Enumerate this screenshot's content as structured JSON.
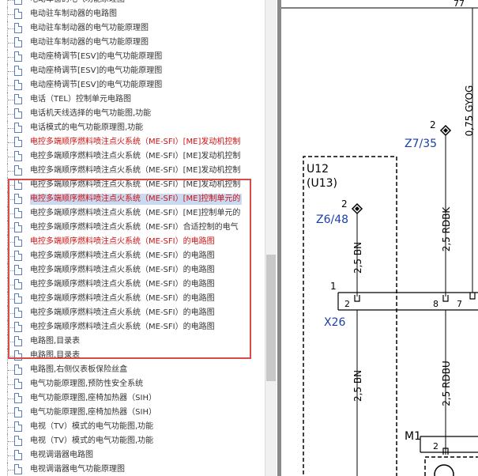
{
  "tree": {
    "items": [
      {
        "label": "电动车窗的电气功能原理图",
        "style": "normal"
      },
      {
        "label": "电动驻车制动器的电路图",
        "style": "normal"
      },
      {
        "label": "电动驻车制动器的电气功能原理图",
        "style": "normal"
      },
      {
        "label": "电动驻车制动器的电气功能原理图",
        "style": "normal"
      },
      {
        "label": "电动座椅调节[ESV]的电气功能原理图",
        "style": "normal"
      },
      {
        "label": "电动座椅调节[ESV]的电气功能原理图",
        "style": "normal"
      },
      {
        "label": "电动座椅调节[ESV]的电气功能原理图",
        "style": "normal"
      },
      {
        "label": "电话（TEL）控制单元电路图",
        "style": "normal"
      },
      {
        "label": "电话机天线选择的电气功能图,功能",
        "style": "normal"
      },
      {
        "label": "电话模式的电气功能原理图,功能",
        "style": "normal"
      },
      {
        "label": "电控多端顺序燃料喷注点火系统（ME-SFI）[ME]发动机控制",
        "style": "red"
      },
      {
        "label": "电控多端顺序燃料喷注点火系统（ME-SFI）[ME]发动机控制",
        "style": "normal"
      },
      {
        "label": "电控多端顺序燃料喷注点火系统（ME-SFI）[ME]发动机控制",
        "style": "normal"
      },
      {
        "label": "电控多端顺序燃料喷注点火系统（ME-SFI）[ME]发动机控制",
        "style": "normal"
      },
      {
        "label": "电控多端顺序燃料喷注点火系统（ME-SFI）[ME]控制单元的",
        "style": "selected"
      },
      {
        "label": "电控多端顺序燃料喷注点火系统（ME-SFI）[ME]控制单元的",
        "style": "normal"
      },
      {
        "label": "电控多端顺序燃料喷注点火系统（ME-SFI）合适控制的电气",
        "style": "normal"
      },
      {
        "label": "电控多端顺序燃料喷注点火系统（ME-SFI）的电路图",
        "style": "red"
      },
      {
        "label": "电控多端顺序燃料喷注点火系统（ME-SFI）的电路图",
        "style": "normal"
      },
      {
        "label": "电控多端顺序燃料喷注点火系统（ME-SFI）的电路图",
        "style": "normal"
      },
      {
        "label": "电控多端顺序燃料喷注点火系统（ME-SFI）的电路图",
        "style": "normal"
      },
      {
        "label": "电控多端顺序燃料喷注点火系统（ME-SFI）的电路图",
        "style": "normal"
      },
      {
        "label": "电控多端顺序燃料喷注点火系统（ME-SFI）的电路图",
        "style": "normal"
      },
      {
        "label": "电控多端顺序燃料喷注点火系统（ME-SFI）的电路图",
        "style": "normal"
      },
      {
        "label": "电路图,目录表",
        "style": "normal"
      },
      {
        "label": "电路图,目录表",
        "style": "normal"
      },
      {
        "label": "电路图,右侧仪表板保险丝盒",
        "style": "normal"
      },
      {
        "label": "电气功能原理图,预防性安全系统",
        "style": "normal"
      },
      {
        "label": "电气功能原理图,座椅加热器（SIH）",
        "style": "normal"
      },
      {
        "label": "电气功能原理图,座椅加热器（SIH）",
        "style": "normal"
      },
      {
        "label": "电视（TV）模式的电气功能图,功能",
        "style": "normal"
      },
      {
        "label": "电视（TV）模式的电气功能图,功能",
        "style": "normal"
      },
      {
        "label": "电视调谐器电路图",
        "style": "normal"
      },
      {
        "label": "电视调谐器电气功能原理图",
        "style": "normal"
      }
    ]
  },
  "diagram": {
    "top_number": "77",
    "wire_top_right": "0,75 GYOG",
    "conn_z735_pin": "2",
    "conn_z735": "Z7/35",
    "conn_z648_pin": "2",
    "conn_z648": "Z6/48",
    "unit_name": "U12",
    "unit_alt": "(U13)",
    "wire_left_upper": "2,5 BN",
    "wire_mid_upper": "2,5 RDBK",
    "bus_num": "1",
    "pin_left": "2",
    "pin_mid": "8",
    "pin_right": "7",
    "conn_x26": "X26",
    "wire_left_lower": "2,5 BN",
    "wire_mid_lower": "2,5 RDBU",
    "conn_m1": "M1",
    "pin_m1": "2"
  },
  "colors": {
    "link_blue": "#1a3fa8",
    "red_text": "#d01010",
    "selection": "#c9dbf2",
    "highlight_box": "#d94a4a"
  }
}
